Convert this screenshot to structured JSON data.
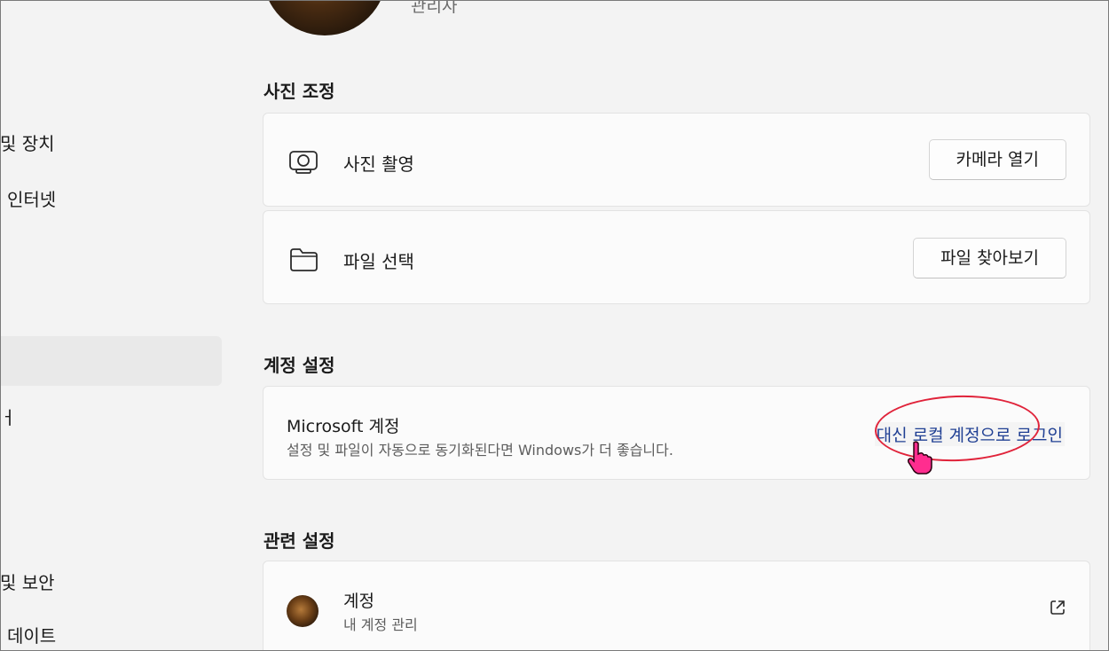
{
  "sidebar": {
    "items": [
      {
        "label": "및 장치"
      },
      {
        "label": "인터넷"
      },
      {
        "label": "ㅓ"
      },
      {
        "label": "및 보안"
      },
      {
        "label": "데이트"
      }
    ]
  },
  "profile": {
    "role": "관리자"
  },
  "photo_section": {
    "title": "사진 조정",
    "take_photo": {
      "label": "사진 촬영",
      "button": "카메라 열기",
      "icon": "camera-icon"
    },
    "choose_file": {
      "label": "파일 선택",
      "button": "파일 찾아보기",
      "icon": "folder-icon"
    }
  },
  "account_section": {
    "title": "계정 설정",
    "ms_account": {
      "title": "Microsoft 계정",
      "description": "설정 및 파일이 자동으로 동기화된다면 Windows가 더 좋습니다.",
      "link": "대신 로컬 계정으로 로그인"
    }
  },
  "related_section": {
    "title": "관련 설정",
    "accounts": {
      "title": "계정",
      "subtitle": "내 계정 관리",
      "icon": "external-link-icon"
    }
  },
  "colors": {
    "link": "#1f3f93",
    "annotation": "#e0233a",
    "cursor": "#e8107a"
  }
}
